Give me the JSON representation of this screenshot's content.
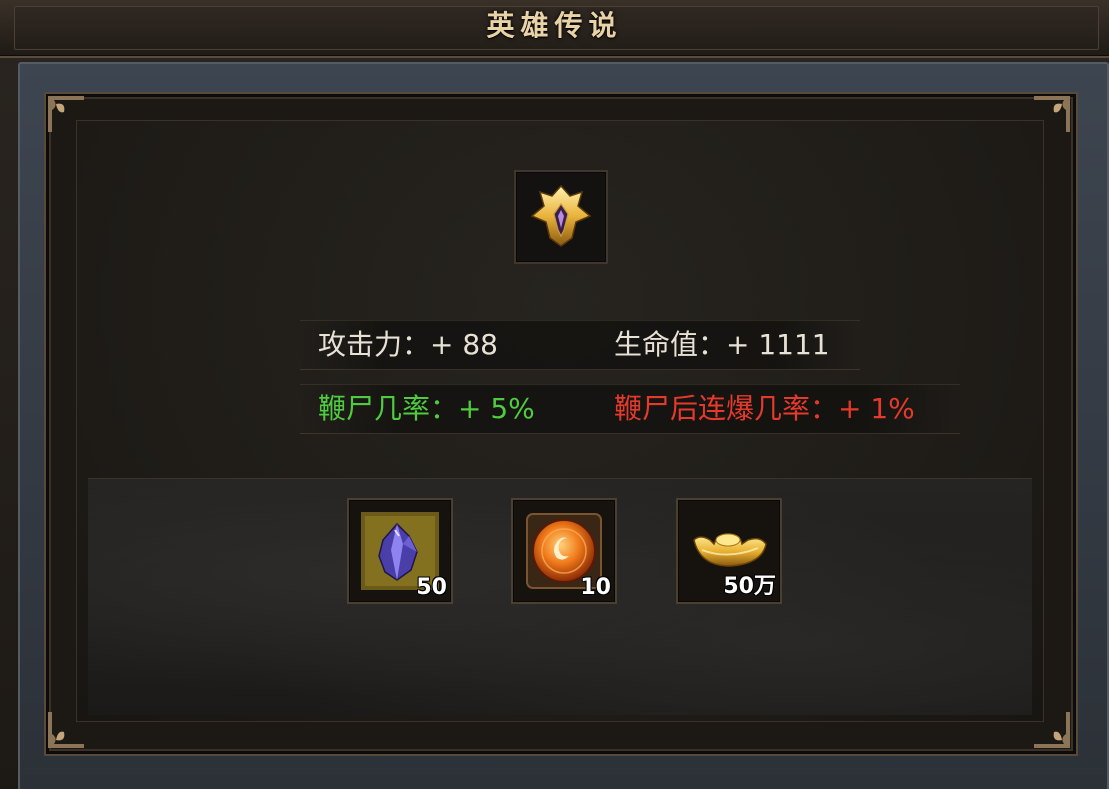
{
  "window": {
    "title": "英雄传说"
  },
  "hero_item": {
    "icon": "golden-emblem-icon"
  },
  "stats": {
    "attack": "攻击力：+ 88",
    "hp": "生命值：+ 1111",
    "whip_rate": "鞭尸几率：+ 5%",
    "whip_chain_rate": "鞭尸后连爆几率：+ 1%"
  },
  "rewards": [
    {
      "icon": "purple-crystal-icon",
      "quantity": "50"
    },
    {
      "icon": "fire-orb-icon",
      "quantity": "10"
    },
    {
      "icon": "gold-ingot-icon",
      "quantity": "50万"
    }
  ],
  "colors": {
    "title_text": "#e9d3a6",
    "stat_white": "#e8e2d6",
    "stat_green": "#4ecb3e",
    "stat_red": "#e53a2b",
    "frame_gold": "#a78d68"
  }
}
